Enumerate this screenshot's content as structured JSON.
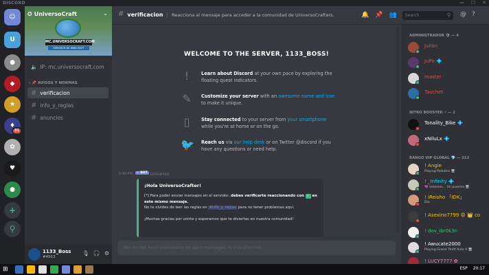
{
  "titlebar": {
    "brand": "DISCORD",
    "minimize": "—",
    "maximize": "☐",
    "close": "✕"
  },
  "guilds": [
    {
      "name": "home",
      "color": "#7289da",
      "glyph": "☺"
    },
    {
      "name": "universocraft",
      "color": "#4aa0d8",
      "glyph": "U"
    },
    {
      "name": "server-a",
      "color": "#8a8a8a",
      "glyph": "●"
    },
    {
      "name": "server-b",
      "color": "#b01e24",
      "glyph": "◆"
    },
    {
      "name": "server-c",
      "color": "#d19e2a",
      "glyph": "★"
    },
    {
      "name": "server-d",
      "color": "#3d3f8f",
      "glyph": "♦",
      "badge": "31"
    },
    {
      "name": "server-e",
      "color": "#b0b0b0",
      "glyph": "✿"
    },
    {
      "name": "server-f",
      "color": "#1a1a1a",
      "glyph": "♥"
    },
    {
      "name": "server-g",
      "color": "#2c8a4a",
      "glyph": "●"
    }
  ],
  "guild_actions": {
    "add": "+",
    "explore": "⚲"
  },
  "server": {
    "name": "UniversoCraft",
    "ip_banner": "MC.UNIVERSOCRAFT.COM",
    "sub_banner": "SERVIDOR DE MINECRAFT",
    "ip_channel": "IP: mc.universocraft.com",
    "category": "AVISOS Y NORMAS",
    "channels": [
      {
        "name": "verificacion",
        "active": true
      },
      {
        "name": "info_y_reglas",
        "active": false
      },
      {
        "name": "anuncios",
        "active": false
      }
    ]
  },
  "user": {
    "name": "1133_Boss",
    "tag": "#4913"
  },
  "topbar": {
    "channel": "verificacion",
    "topic": "Reacciona al mensaje para acceder a la comunidad de UniversoCrafters.",
    "search_placeholder": "Search"
  },
  "welcome": {
    "title": "WELCOME TO THE SERVER, 1133_BOSS!",
    "tips": [
      {
        "icon": "!",
        "bold": "Learn about Discord",
        "text": " at your own pace by exploring the floating quest indicators.",
        "link": "",
        "after": ""
      },
      {
        "icon": "✎",
        "bold": "Customize your server",
        "text": " with an ",
        "link": "awesome name and icon",
        "after": " to make it unique."
      },
      {
        "icon": "▯",
        "bold": "Stay connected",
        "text": " to your server from ",
        "link": "your smartphone",
        "after": " while you're at home or on the go."
      },
      {
        "icon": "🐦",
        "bold": "Reach us",
        "text": " via ",
        "link": "our help desk",
        "after": " or on Twitter @discord if you have any questions or need help."
      }
    ]
  },
  "message": {
    "time": "5:49 PM",
    "bot_badge": "✓ BOT",
    "author": "Universo",
    "embed_title": "¡Hola UniversoCrafter!",
    "line1_pre": "[*] Para poder enviar mensajes en el servidor, ",
    "line1_bold": "debes verificarte reaccionando con",
    "line1_check": "✓",
    "line1_post": " en este mismo mensaje.",
    "line2_pre": "No te olvides de leer las reglas en ",
    "line2_mention": "#info_y_reglas",
    "line2_post": " para no tener problemas aquí.",
    "line3": "¡Muchas gracias por unirte y esperamos que te diviertas en nuestra comunidad!"
  },
  "input_placeholder": "You do not have permission to send messages in this channel.",
  "members": {
    "categories": [
      {
        "label": "ADMINISTRADOR 🛡 — 4"
      },
      {
        "label": "NITRO BOOSTER ⚡ — 2"
      },
      {
        "label": "RANGO VIP GLOBAL 💎 — 212"
      }
    ],
    "list": [
      {
        "name": "Julián",
        "color": "#e74c3c",
        "av": "#9b4a3a",
        "status": "#43b581"
      },
      {
        "name": "JuPo 💠",
        "color": "#e74c3c",
        "av": "#5a3a6a",
        "status": "#43b581"
      },
      {
        "name": "master",
        "color": "#e74c3c",
        "av": "#d8d8d8",
        "status": "#43b581"
      },
      {
        "name": "Tauchet",
        "color": "#e74c3c",
        "av": "#2a6fa8",
        "status": "#43b581"
      },
      {
        "name": "Tonality_Bike 💠",
        "color": "#ffffff",
        "av": "#111111",
        "status": "#f04747"
      },
      {
        "name": "xNiluLx 💠",
        "color": "#ffffff",
        "av": "#c06a78",
        "status": "#f04747"
      },
      {
        "name": "! Angie",
        "color": "#f1c40f",
        "av": "#e7d3c0",
        "status": "#43b581",
        "sub": "Playing Paladins 🖥"
      },
      {
        "name": "! _Infinity 💠",
        "color": "#00e0ff",
        "av": "#c8c8b8",
        "status": "#43b581",
        "sub": "💜 estamos... Un puerma 🖥"
      },
      {
        "name": "! iReisho 「IDK」",
        "color": "#f1c40f",
        "av": "#d49a7a",
        "status": "#f04747",
        "sub": "Dia"
      },
      {
        "name": "! Asexino7799 😡 👑 co",
        "color": "#f1c40f",
        "av": "#3c3c3c",
        "status": "#f04747"
      },
      {
        "name": "! dov_ibr0k3n",
        "color": "#2ecc71",
        "av": "#f0f0f0",
        "status": "#43b581"
      },
      {
        "name": "! Awucate2000",
        "color": "#ffffff",
        "av": "#dcdcdc",
        "status": "#43b581",
        "sub": "Playing Grand Theft Auto V 🖥"
      },
      {
        "name": "! LUCY7777 ✿",
        "color": "#ff7bb0",
        "av": "#a02a3a",
        "status": "#f04747"
      }
    ]
  },
  "taskbar": {
    "start": "⊞",
    "apps": [
      "#3a6fb8",
      "#ffb900",
      "#e0e0e0",
      "#34a853",
      "#7289da",
      "#e0a030",
      "#9a7a4a"
    ],
    "lang": "ESP",
    "time": "20:17"
  }
}
